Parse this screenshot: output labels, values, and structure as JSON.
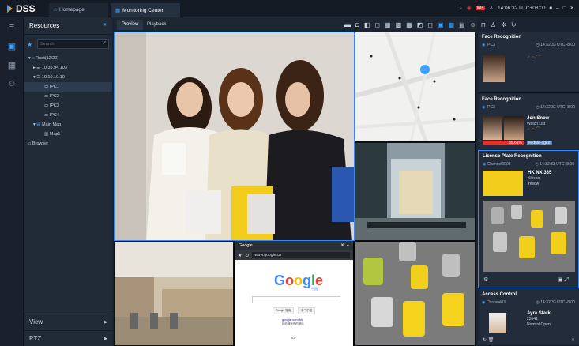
{
  "app": {
    "name": "DSS"
  },
  "tabs": [
    {
      "label": "Homepage"
    },
    {
      "label": "Monitoring Center"
    }
  ],
  "status": {
    "alarm_count": "99+",
    "time": "14:06:32 UTC+08:00"
  },
  "resources": {
    "title": "Resources",
    "search_placeholder": "Search",
    "tree": [
      {
        "label": "Root(12/20)"
      },
      {
        "label": "10.35.94.103"
      },
      {
        "label": "10.10.10.10"
      },
      {
        "label": "IPC1"
      },
      {
        "label": "IPC2"
      },
      {
        "label": "IPC3"
      },
      {
        "label": "IPC4"
      },
      {
        "label": "Main Map"
      },
      {
        "label": "Map1"
      },
      {
        "label": "Browser"
      }
    ],
    "footer": [
      {
        "label": "View"
      },
      {
        "label": "PTZ"
      }
    ]
  },
  "view_tabs": {
    "preview": "Preview",
    "playback": "Playback"
  },
  "browser": {
    "tab_title": "Google",
    "url": "www.google.cn",
    "logo": "Google",
    "logo_sub": "中国",
    "btn1": "Google 搜索",
    "btn2": "手气不错",
    "link": "google.com.hk",
    "small": "請收藏我們的網址",
    "footer_link": "ICP"
  },
  "events": {
    "face1": {
      "title": "Face Recognition",
      "channel": "IPC3",
      "time": "14:32:33 UTC+8:00"
    },
    "face2": {
      "title": "Face Recognition",
      "channel": "IPC3",
      "time": "14:32:33 UTC+8:00",
      "name": "Jon Snow",
      "list": "Watch List",
      "similarity": "85.61%",
      "age": "Middle-aged"
    },
    "plate": {
      "title": "License Plate Recognition",
      "channel": "Channel0003",
      "time": "14:32:33 UTC+8:00",
      "number": "HK NX 335",
      "brand": "Nissan",
      "color": "Yellow"
    },
    "access": {
      "title": "Access Control",
      "channel": "Channel03",
      "time": "14:32:33 UTC+8:00",
      "name": "Ayra Stark",
      "id": "23541",
      "state": "Normal Open"
    }
  },
  "colors": {
    "accent": "#2c8cff",
    "bg": "#1b2330",
    "panel": "#212a37"
  }
}
